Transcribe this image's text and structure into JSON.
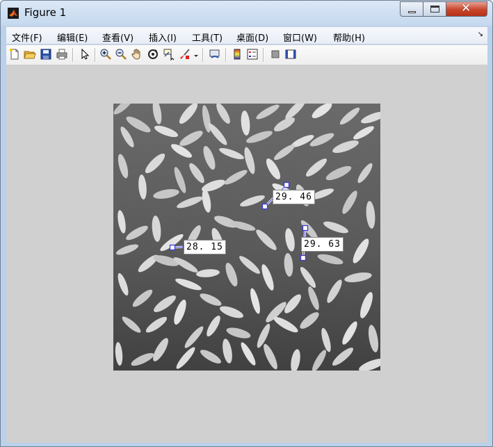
{
  "window": {
    "title": "Figure 1"
  },
  "menu": {
    "file": "文件(F)",
    "edit": "编辑(E)",
    "view": "查看(V)",
    "insert": "插入(I)",
    "tools": "工具(T)",
    "desktop": "桌面(D)",
    "window": "窗口(W)",
    "help": "帮助(H)"
  },
  "toolbar_icons": [
    "new-figure-icon",
    "open-file-icon",
    "save-icon",
    "print-icon",
    "edit-plot-arrow-icon",
    "zoom-in-icon",
    "zoom-out-icon",
    "pan-hand-icon",
    "rotate-3d-icon",
    "data-cursor-icon",
    "brush-icon",
    "link-plot-icon",
    "insert-colorbar-icon",
    "insert-legend-icon",
    "hide-plot-tools-icon",
    "show-plot-tools-icon"
  ],
  "image": {
    "subject": "grayscale rice grains",
    "background_color": "#5a5a5a"
  },
  "measurements": [
    {
      "label": "28. 15"
    },
    {
      "label": "29. 46"
    },
    {
      "label": "29. 63"
    }
  ],
  "colors": {
    "figure_bg": "#d0d0d0",
    "marker": "#3b3bd6",
    "title_bg": "#c4d8ee"
  }
}
